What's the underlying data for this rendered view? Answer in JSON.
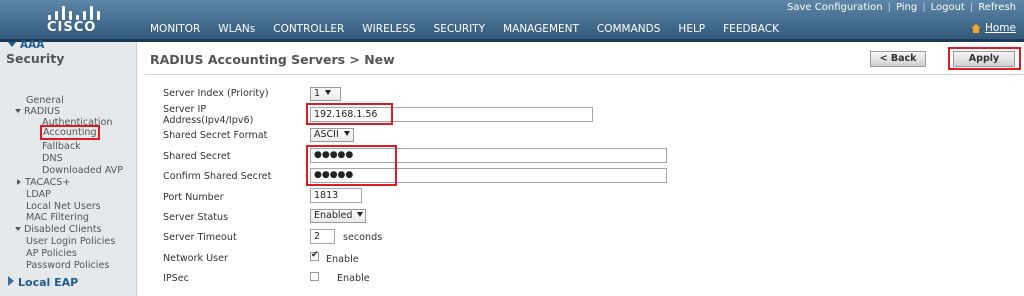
{
  "brand": {
    "logo_text": "CISCO"
  },
  "utility_links": [
    "Save Configuration",
    "Ping",
    "Logout",
    "Refresh"
  ],
  "home_label": "Home",
  "nav": [
    "MONITOR",
    "WLANs",
    "CONTROLLER",
    "WIRELESS",
    "SECURITY",
    "MANAGEMENT",
    "COMMANDS",
    "HELP",
    "FEEDBACK"
  ],
  "active_nav": "SECURITY",
  "sidebar": {
    "title": "Security",
    "aaa": "AAA",
    "general": "General",
    "radius": "RADIUS",
    "authentication": "Authentication",
    "accounting": "Accounting",
    "fallback": "Fallback",
    "dns": "DNS",
    "downloaded_avp": "Downloaded AVP",
    "tacacs": "TACACS+",
    "ldap": "LDAP",
    "local_net_users": "Local Net Users",
    "mac_filtering": "MAC Filtering",
    "disabled_clients": "Disabled Clients",
    "user_login_policies": "User Login Policies",
    "ap_policies": "AP Policies",
    "password_policies": "Password Policies",
    "local_eap": "Local EAP"
  },
  "page": {
    "title": "RADIUS Accounting Servers > New",
    "back_label": "< Back",
    "apply_label": "Apply"
  },
  "form": {
    "server_index_label": "Server Index (Priority)",
    "server_index_value": "1",
    "server_ip_label_1": "Server IP",
    "server_ip_label_2": "Address(Ipv4/Ipv6)",
    "server_ip_value": "192.168.1.56",
    "secret_format_label": "Shared Secret Format",
    "secret_format_value": "ASCII",
    "shared_secret_label": "Shared Secret",
    "shared_secret_value": "●●●●●",
    "confirm_secret_label": "Confirm Shared Secret",
    "confirm_secret_value": "●●●●●",
    "port_label": "Port Number",
    "port_value": "1813",
    "status_label": "Server Status",
    "status_value": "Enabled",
    "timeout_label": "Server Timeout",
    "timeout_value": "2",
    "timeout_unit": "seconds",
    "network_user_label": "Network User",
    "network_user_checked": true,
    "network_user_text": "Enable",
    "ipsec_label": "IPSec",
    "ipsec_checked": false,
    "ipsec_text": "Enable"
  },
  "colors": {
    "header_top": "#5d86a8",
    "header_bottom": "#2f5677",
    "active_tab": "#f2a72b",
    "highlight": "#e01b24",
    "sidebar_bg": "#e6e9ec",
    "link_blue": "#1f5b8e"
  }
}
